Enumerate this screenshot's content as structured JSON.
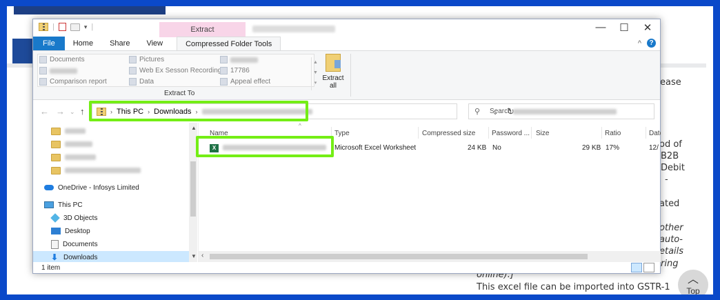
{
  "background": {
    "text_lines": [
      {
        "text": "ease",
        "italic": false
      },
      {
        "text": "od of",
        "italic": false
      },
      {
        "text": "B2B",
        "italic": false
      },
      {
        "text": "Debit",
        "italic": false
      },
      {
        "text": "-",
        "italic": false
      },
      {
        "text": "ated",
        "italic": false
      },
      {
        "text": "other",
        "italic": true
      },
      {
        "text": "auto-",
        "italic": true
      },
      {
        "text": "etails",
        "italic": true
      },
      {
        "text": "ring",
        "italic": true
      },
      {
        "text": "online).]",
        "italic": true
      },
      {
        "text": "This excel file can be imported into GSTR-1",
        "italic": false
      }
    ],
    "top_button_label": "Top",
    "top_button_icon": "chevron-up-icon"
  },
  "window": {
    "quick_access_icons": [
      "zip-folder-icon",
      "properties-icon",
      "new-folder-icon",
      "customize-arrow-icon"
    ],
    "contextual_tab": "Extract",
    "controls": {
      "minimize": "—",
      "maximize": "☐",
      "close": "✕"
    }
  },
  "ribbon": {
    "tabs": [
      {
        "label": "File",
        "kind": "file"
      },
      {
        "label": "Home",
        "kind": "normal"
      },
      {
        "label": "Share",
        "kind": "normal"
      },
      {
        "label": "View",
        "kind": "normal"
      },
      {
        "label": "Compressed Folder Tools",
        "kind": "active"
      }
    ],
    "collapse_icon": "^",
    "help_icon": "?",
    "extract_to_items": [
      {
        "label": "Documents"
      },
      {
        "label": "Pictures"
      },
      {
        "label": ""
      },
      {
        "label": ""
      },
      {
        "label": "Web Ex Sesson Recordings"
      },
      {
        "label": "17786"
      },
      {
        "label": "Comparison report"
      },
      {
        "label": "Data"
      },
      {
        "label": "Appeal effect"
      }
    ],
    "group_label": "Extract To",
    "extract_all_line1": "Extract",
    "extract_all_line2": "all"
  },
  "address_bar": {
    "back": "←",
    "forward": "→",
    "dropdown": "⌄",
    "up": "↑",
    "crumbs": [
      "This PC",
      "Downloads"
    ],
    "search_label": "Search",
    "refresh": "↻"
  },
  "nav_pane": {
    "items": [
      {
        "label": "",
        "icon": "folder-icon",
        "blurred": true
      },
      {
        "label": "",
        "icon": "folder-icon",
        "blurred": true
      },
      {
        "label": "",
        "icon": "folder-icon",
        "blurred": true
      },
      {
        "label": "",
        "icon": "folder-icon",
        "blurred": true
      },
      {
        "label": "OneDrive - Infosys Limited",
        "icon": "onedrive-icon"
      },
      {
        "label": "This PC",
        "icon": "this-pc-icon"
      },
      {
        "label": "3D Objects",
        "icon": "3d-objects-icon"
      },
      {
        "label": "Desktop",
        "icon": "desktop-icon"
      },
      {
        "label": "Documents",
        "icon": "documents-icon"
      },
      {
        "label": "Downloads",
        "icon": "downloads-icon",
        "selected": true
      }
    ]
  },
  "file_list": {
    "columns": [
      "Name",
      "Type",
      "Compressed size",
      "Password ...",
      "Size",
      "Ratio",
      "Datem"
    ],
    "rows": [
      {
        "name": "",
        "type": "Microsoft Excel Worksheet",
        "compressed_size": "24 KB",
        "password": "No",
        "size": "29 KB",
        "ratio": "17%",
        "date": "12/"
      }
    ]
  },
  "status_bar": {
    "item_count": "1 item"
  },
  "colors": {
    "highlight": "#74ee15",
    "file_tab": "#1979ca",
    "contextual_tab": "#f8d5e8",
    "page_border": "#0b49c9"
  }
}
